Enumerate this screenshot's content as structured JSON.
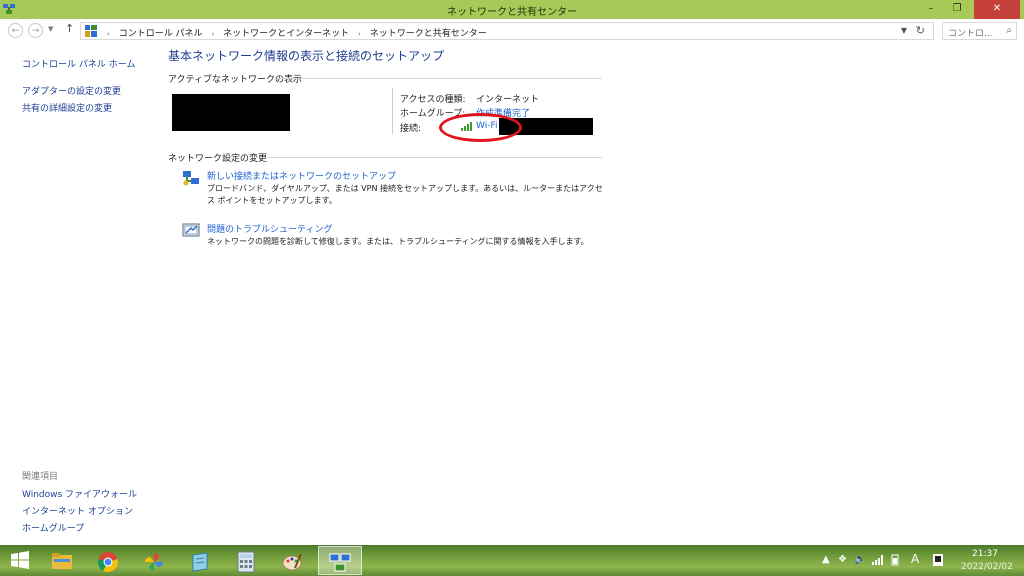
{
  "window": {
    "title": "ネットワークと共有センター",
    "minimize": "–",
    "maximize": "❐",
    "close": "✕",
    "accent_color": "#a6c957"
  },
  "address_bar": {
    "back": "←",
    "forward": "→",
    "dropdown": "▼",
    "up": "↑",
    "breadcrumbs": [
      "コントロール パネル",
      "ネットワークとインターネット",
      "ネットワークと共有センター"
    ],
    "separator": "›",
    "refresh": "↻",
    "search_placeholder": "コントロ...",
    "search_icon": "⌕"
  },
  "left_pane": {
    "home": "コントロール パネル ホーム",
    "adapter_settings": "アダプターの設定の変更",
    "advanced_sharing": "共有の詳細設定の変更",
    "related_heading": "関連項目",
    "firewall": "Windows ファイアウォール",
    "internet_options": "インターネット オプション",
    "homegroup": "ホームグループ"
  },
  "main": {
    "title": "基本ネットワーク情報の表示と接続のセットアップ",
    "active_networks_heading": "アクティブなネットワークの表示",
    "access_type_label": "アクセスの種類:",
    "access_type_value": "インターネット",
    "homegroup_label": "ホームグループ:",
    "homegroup_value": "作成準備完了",
    "connection_label": "接続:",
    "connection_value": "Wi-Fi",
    "change_settings_heading": "ネットワーク設定の変更",
    "tasks": [
      {
        "title": "新しい接続またはネットワークのセットアップ",
        "description": "ブロードバンド、ダイヤルアップ、または VPN 接続をセットアップします。あるいは、ルーターまたはアクセス ポイントをセットアップします。"
      },
      {
        "title": "問題のトラブルシューティング",
        "description": "ネットワークの問題を診断して修復します。または、トラブルシューティングに関する情報を入手します。"
      }
    ]
  },
  "taskbar": {
    "apps": [
      "start-icon",
      "file-explorer-icon",
      "chrome-icon",
      "photos-icon",
      "notepad-icon",
      "calculator-icon",
      "paint-icon",
      "network-center-icon"
    ],
    "ime_label": "A",
    "time": "21:37",
    "date": "2022/02/02"
  }
}
